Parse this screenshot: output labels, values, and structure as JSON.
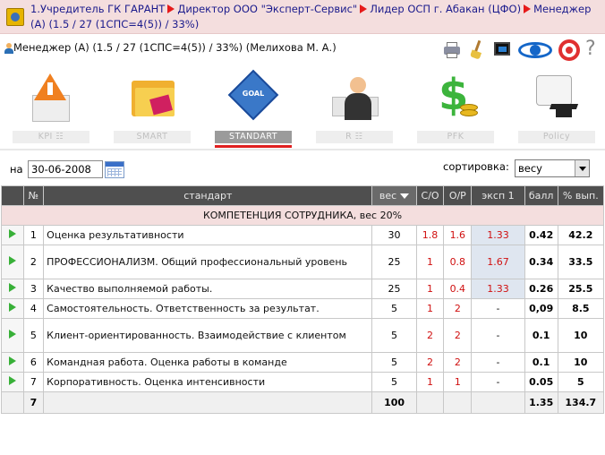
{
  "breadcrumb": {
    "items": [
      "1.Учредитель ГК ГАРАНТ",
      "Директор ООО \"Эксперт-Сервис\"",
      "Лидер ОСП г. Абакан (ЦФО)",
      "Менеджер (А) (1.5 / 27 (1СПС=4(5)) / 33%)"
    ]
  },
  "user": {
    "text": "Менеджер (А) (1.5 / 27 (1СПС=4(5)) / 33%)  (Мелихова М. А.)"
  },
  "toolbar": {
    "help": "?"
  },
  "nav": {
    "tabs": [
      {
        "label": "KPI ☷",
        "active": false
      },
      {
        "label": "SMART",
        "active": false
      },
      {
        "label": "STANDART",
        "active": true
      },
      {
        "label": "R ☷",
        "active": false
      },
      {
        "label": "PFK",
        "active": false
      },
      {
        "label": "Policy",
        "active": false
      }
    ],
    "goal_text": "GOAL"
  },
  "filter": {
    "date_label": "на",
    "date_value": "30-06-2008",
    "sort_label": "сортировка:",
    "sort_value": "весу"
  },
  "table": {
    "headers": {
      "no": "№",
      "standard": "стандарт",
      "weight": "вес",
      "co": "С/О",
      "op": "О/Р",
      "exp": "эксп 1",
      "score": "балл",
      "pct": "% вып."
    },
    "section": "КОМПЕТЕНЦИЯ СОТРУДНИКА, вес 20%",
    "rows": [
      {
        "no": "1",
        "name": "Оценка результативности",
        "weight": "30",
        "co": "1.8",
        "op": "1.6",
        "exp": "1.33",
        "score": "0.42",
        "pct": "42.2"
      },
      {
        "no": "2",
        "name": "ПРОФЕССИОНАЛИЗМ. Общий профессиональный уровень",
        "weight": "25",
        "co": "1",
        "op": "0.8",
        "exp": "1.67",
        "score": "0.34",
        "pct": "33.5"
      },
      {
        "no": "3",
        "name": "Качество выполняемой работы.",
        "weight": "25",
        "co": "1",
        "op": "0.4",
        "exp": "1.33",
        "score": "0.26",
        "pct": "25.5"
      },
      {
        "no": "4",
        "name": "Самостоятельность. Ответственность за результат.",
        "weight": "5",
        "co": "1",
        "op": "2",
        "exp": "-",
        "score": "0,09",
        "pct": "8.5"
      },
      {
        "no": "5",
        "name": "Клиент-ориентированность. Взаимодействие с клиентом",
        "weight": "5",
        "co": "2",
        "op": "2",
        "exp": "-",
        "score": "0.1",
        "pct": "10"
      },
      {
        "no": "6",
        "name": "Командная работа. Оценка работы в команде",
        "weight": "5",
        "co": "2",
        "op": "2",
        "exp": "-",
        "score": "0.1",
        "pct": "10"
      },
      {
        "no": "7",
        "name": "Корпоративность. Оценка интенсивности",
        "weight": "5",
        "co": "1",
        "op": "1",
        "exp": "-",
        "score": "0.05",
        "pct": "5"
      }
    ],
    "total": {
      "no": "7",
      "weight": "100",
      "score": "1.35",
      "pct": "134.7"
    }
  }
}
